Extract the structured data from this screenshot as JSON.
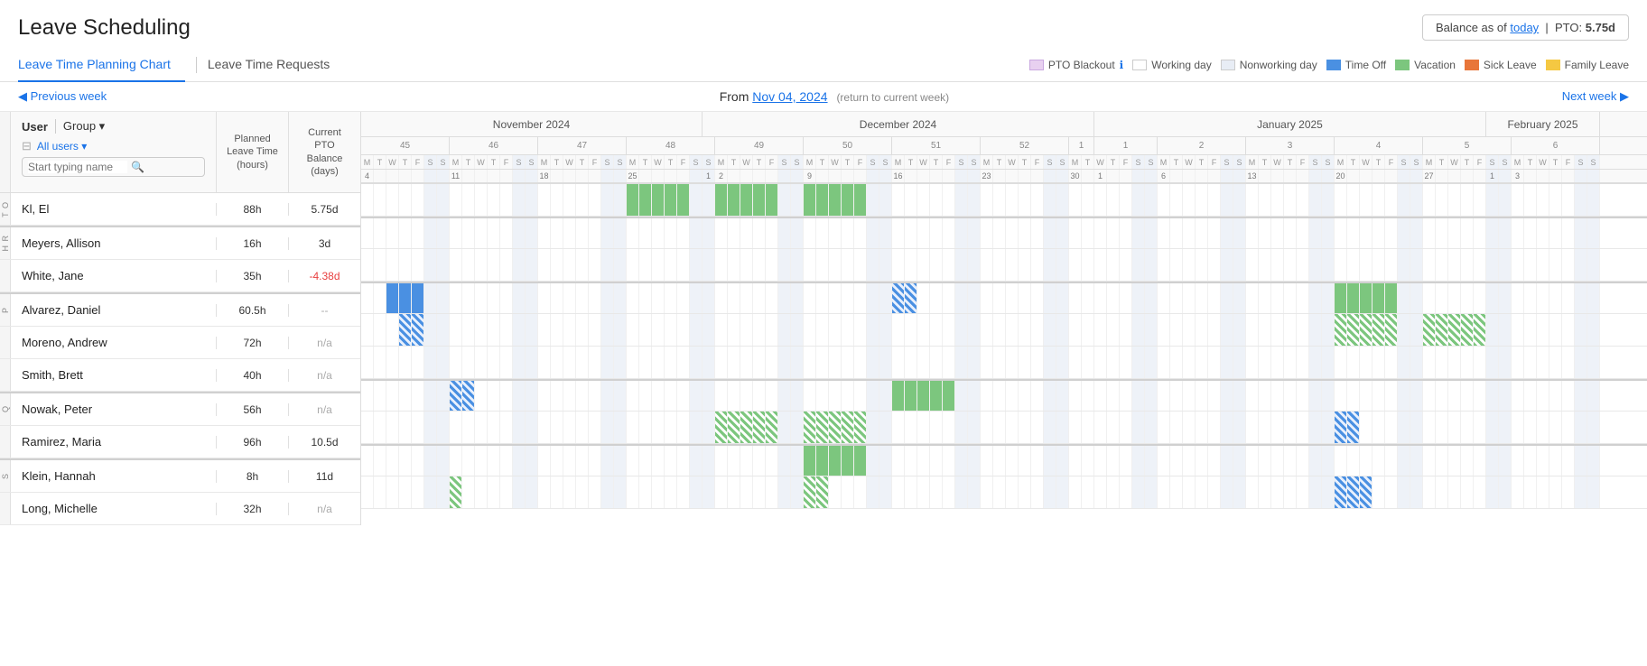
{
  "page": {
    "title": "Leave Scheduling",
    "balance_label": "Balance as of",
    "today_link": "today",
    "pto_label": "PTO:",
    "pto_value": "5.75d"
  },
  "tabs": [
    {
      "id": "planning",
      "label": "Leave Time Planning Chart",
      "active": true
    },
    {
      "id": "requests",
      "label": "Leave Time Requests",
      "active": false
    }
  ],
  "legend": [
    {
      "id": "pto-blackout",
      "label": "PTO Blackout",
      "swatch": "pto-blackout"
    },
    {
      "id": "working-day",
      "label": "Working day",
      "swatch": "working-day"
    },
    {
      "id": "nonworking-day",
      "label": "Nonworking day",
      "swatch": "nonworking-day"
    },
    {
      "id": "time-off",
      "label": "Time Off",
      "swatch": "time-off"
    },
    {
      "id": "vacation",
      "label": "Vacation",
      "swatch": "vacation"
    },
    {
      "id": "sick-leave",
      "label": "Sick Leave",
      "swatch": "sick-leave"
    },
    {
      "id": "family-leave",
      "label": "Family Leave",
      "swatch": "family-leave"
    }
  ],
  "nav": {
    "prev_label": "◀ Previous week",
    "next_label": "Next week ▶",
    "from_label": "From",
    "from_date": "Nov 04, 2024",
    "return_label": "(return to current week)"
  },
  "table": {
    "col_user": "User",
    "col_group": "Group",
    "col_planned": "Planned Leave Time (hours)",
    "col_pto": "Current PTO Balance (days)",
    "filter_label": "All users",
    "search_placeholder": "Start typing name",
    "departments": [
      {
        "id": "to",
        "label": "T O",
        "rows": [
          {
            "name": "Kl, El",
            "planned": "88h",
            "pto": "5.75d",
            "pto_class": "pto-positive"
          }
        ]
      },
      {
        "id": "hr",
        "label": "H R & ",
        "rows": [
          {
            "name": "Meyers, Allison",
            "planned": "16h",
            "pto": "3d",
            "pto_class": "pto-positive"
          },
          {
            "name": "White, Jane",
            "planned": "35h",
            "pto": "-4.38d",
            "pto_class": "pto-negative"
          }
        ]
      },
      {
        "id": "product",
        "label": "P R O D U C T",
        "rows": [
          {
            "name": "Alvarez, Daniel",
            "planned": "60.5h",
            "pto": "--",
            "pto_class": "pto-dashes"
          },
          {
            "name": "Moreno, Andrew",
            "planned": "72h",
            "pto": "n/a",
            "pto_class": "pto-na"
          },
          {
            "name": "Smith, Brett",
            "planned": "40h",
            "pto": "n/a",
            "pto_class": "pto-na"
          }
        ]
      },
      {
        "id": "qual",
        "label": "Q U A L",
        "rows": [
          {
            "name": "Nowak, Peter",
            "planned": "56h",
            "pto": "n/a",
            "pto_class": "pto-na"
          },
          {
            "name": "Ramirez, Maria",
            "planned": "96h",
            "pto": "10.5d",
            "pto_class": "pto-positive"
          }
        ]
      },
      {
        "id": "sale",
        "label": "S A L E",
        "rows": [
          {
            "name": "Klein, Hannah",
            "planned": "8h",
            "pto": "11d",
            "pto_class": "pto-positive"
          },
          {
            "name": "Long, Michelle",
            "planned": "32h",
            "pto": "n/a",
            "pto_class": "pto-na"
          }
        ]
      }
    ]
  }
}
